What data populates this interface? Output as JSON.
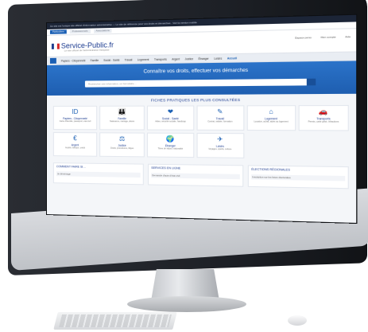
{
  "topbar": {
    "text": "Ce site est l'unique site officiel d'information administrative — Le site de référence pour vos droits et démarches · Voir la version mobile"
  },
  "subbar": {
    "tabs": [
      "Particuliers",
      "Professionnels",
      "Associations"
    ],
    "right": "Mon compte"
  },
  "header": {
    "brand": "Service-Public.fr",
    "subtitle": "Le site officiel de l'administration française",
    "links": [
      "Espace perso",
      "Mon compte",
      "Aide"
    ]
  },
  "nav": {
    "items": [
      "Papiers - Citoyenneté",
      "Famille",
      "Social - Santé",
      "Travail",
      "Logement",
      "Transports",
      "Argent",
      "Justice",
      "Étranger",
      "Loisirs",
      "Accueil"
    ]
  },
  "hero": {
    "title": "Connaître vos droits, effectuer vos démarches",
    "search_placeholder": "Rechercher une information, un formulaire…"
  },
  "fiches": {
    "title": "FICHES PRATIQUES LES PLUS CONSULTÉES",
    "cards": [
      {
        "icon": "ID",
        "title": "Papiers - Citoyenneté",
        "desc": "Carte d'identité, passeport, état civil"
      },
      {
        "icon": "👪",
        "title": "Famille",
        "desc": "Naissance, mariage, décès"
      },
      {
        "icon": "❤",
        "title": "Social - Santé",
        "desc": "Aides, sécurité sociale, handicap"
      },
      {
        "icon": "✎",
        "title": "Travail",
        "desc": "Contrat, salaire, formation"
      },
      {
        "icon": "⌂",
        "title": "Logement",
        "desc": "Location, achat, aides au logement"
      },
      {
        "icon": "🚗",
        "title": "Transports",
        "desc": "Permis, carte grise, infractions"
      },
      {
        "icon": "€",
        "title": "Argent",
        "desc": "Impôts, banque, crédit"
      },
      {
        "icon": "⚖",
        "title": "Justice",
        "desc": "Droits, procédures, litiges"
      },
      {
        "icon": "🌍",
        "title": "Étranger",
        "desc": "Titres de séjour, nationalité"
      },
      {
        "icon": "✈",
        "title": "Loisirs",
        "desc": "Voyages, sports, culture"
      }
    ]
  },
  "panels": [
    {
      "title": "COMMENT FAIRE SI…",
      "item": "Je déménage"
    },
    {
      "title": "SERVICES EN LIGNE",
      "item": "Demande d'acte d'état civil"
    },
    {
      "title": "ÉLECTIONS RÉGIONALES",
      "item": "Inscription sur les listes électorales"
    }
  ]
}
